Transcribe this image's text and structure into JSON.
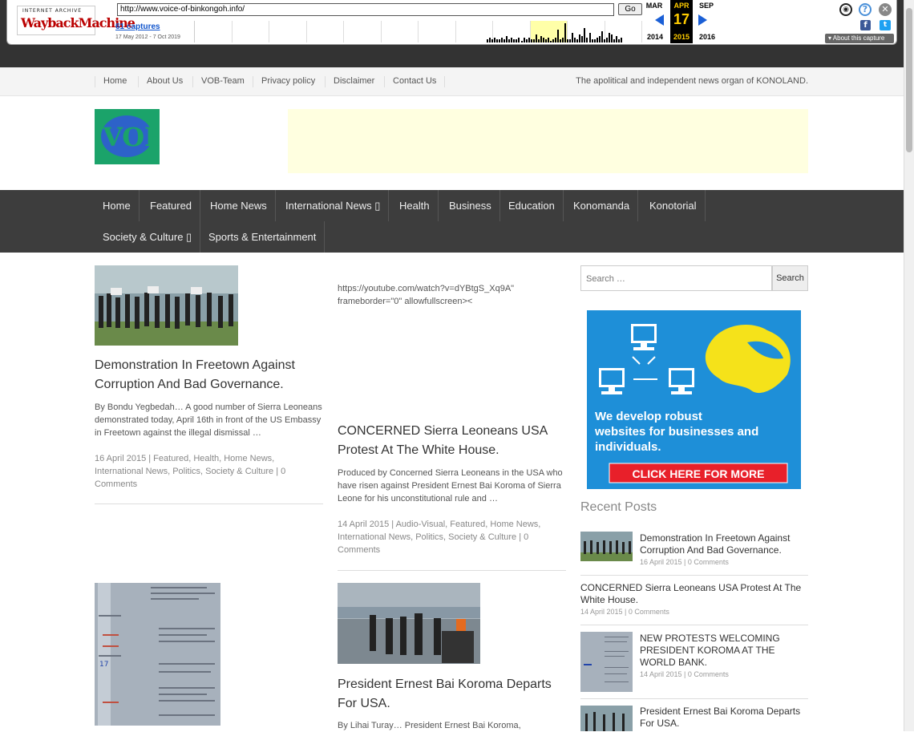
{
  "wayback": {
    "logo_top": "INTERNET ARCHIVE",
    "logo_main": "WaybackMachine",
    "url": "http://www.voice-of-binkongoh.info/",
    "go": "Go",
    "captures": "61 captures",
    "range": "17 May 2012 - 7 Oct 2019",
    "prev_month": "MAR",
    "cur_month": "APR",
    "next_month": "SEP",
    "day": "17",
    "prev_year": "2014",
    "cur_year": "2015",
    "next_year": "2016",
    "about": "About this capture",
    "sparkline": [
      2,
      3,
      2,
      3,
      2,
      2,
      3,
      2,
      4,
      2,
      3,
      2,
      2,
      3,
      1,
      3,
      2,
      3,
      2,
      2,
      5,
      2,
      4,
      3,
      2,
      3,
      1,
      2,
      3,
      8,
      2,
      3,
      12,
      2,
      2,
      6,
      3,
      2,
      5,
      4,
      9,
      3,
      6,
      2,
      2,
      3,
      4,
      7,
      2,
      3,
      6,
      5,
      2,
      4,
      2,
      3
    ],
    "colors": {
      "highlight": "#ffffa8",
      "current": "#000000",
      "accent": "#fc0"
    },
    "icons": [
      "user-icon",
      "help-icon",
      "close-icon",
      "facebook-icon",
      "twitter-icon"
    ]
  },
  "topbar": {
    "links": [
      "Home",
      "About Us",
      "VOB-Team",
      "Privacy policy",
      "Disclaimer",
      "Contact Us"
    ],
    "tagline": "The apolitical and independent news organ of KONOLAND."
  },
  "logo": {
    "text": "VOB"
  },
  "nav": {
    "row1": [
      "Home",
      "Featured",
      "Home News",
      "International News ▯",
      "Health",
      "Business",
      "Education",
      "Konomanda",
      "Konotorial"
    ],
    "row2": [
      "Society & Culture ▯",
      "Sports & Entertainment"
    ]
  },
  "posts": [
    {
      "title": "Demonstration In Freetown Against Corruption And Bad Governance.",
      "excerpt": "By Bondu Yegbedah… A good number of Sierra Leoneans demonstrated today, April 16th in front of the US Embassy in Freetown against the illegal dismissal …",
      "meta": "16 April 2015 | Featured, Health, Home News, International News, Politics, Society & Culture | 0 Comments"
    },
    {
      "embed": "https://youtube.com/watch?v=dYBtgS_Xq9A\" frameborder=\"0\" allowfullscreen><",
      "title": "CONCERNED Sierra Leoneans USA Protest At The White House.",
      "excerpt": "Produced by Concerned Sierra Leoneans in the USA who have risen against President Ernest Bai Koroma of Sierra Leone for his unconstitutional rule and …",
      "meta": "14 April 2015 | Audio-Visual, Featured, Home News, International News, Politics, Society & Culture | 0 Comments"
    },
    {
      "title": "President Ernest Bai Koroma Departs For USA.",
      "excerpt": "By Lihai Turay… President Ernest Bai Koroma,"
    }
  ],
  "sidebar": {
    "search_placeholder": "Search …",
    "search_button": "Search",
    "banner_line1": "We develop robust",
    "banner_line2": "websites for businesses and",
    "banner_line3": "individuals.",
    "banner_cta": "CLICK HERE FOR MORE",
    "recent_title": "Recent Posts",
    "recent": [
      {
        "title": "Demonstration In Freetown Against Corruption And Bad Governance.",
        "meta": "16 April 2015 | 0 Comments"
      },
      {
        "title": "CONCERNED Sierra Leoneans USA Protest At The White House.",
        "meta": "14 April 2015 | 0 Comments"
      },
      {
        "title": "NEW PROTESTS WELCOMING PRESIDENT KOROMA AT THE WORLD BANK.",
        "meta": "14 April 2015 | 0 Comments"
      },
      {
        "title": "President Ernest Bai Koroma Departs For USA.",
        "meta": ""
      }
    ]
  }
}
